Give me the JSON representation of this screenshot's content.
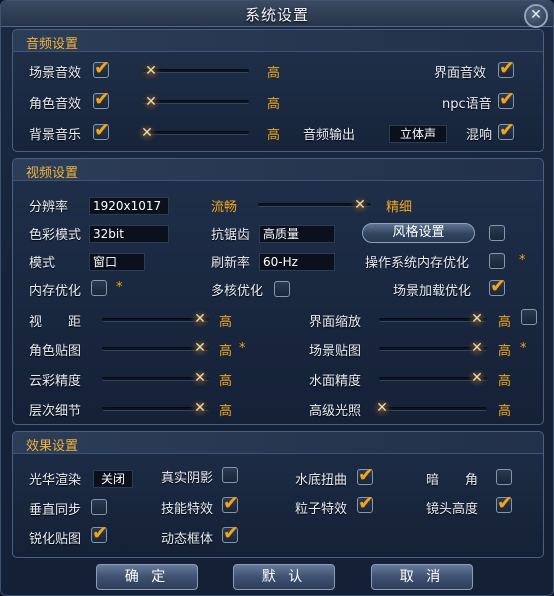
{
  "window": {
    "title": "系统设置",
    "close_glyph": "✕"
  },
  "audio": {
    "header": "音频设置",
    "scene_sound": {
      "label": "场景音效",
      "checked": true,
      "value": "高"
    },
    "role_sound": {
      "label": "角色音效",
      "checked": true,
      "value": "高"
    },
    "bgm": {
      "label": "背景音乐",
      "checked": true,
      "value": "高"
    },
    "ui_sound": {
      "label": "界面音效",
      "checked": true
    },
    "npc_voice": {
      "label": "npc语音",
      "checked": true
    },
    "output": {
      "label": "音频输出",
      "value": "立体声"
    },
    "reverb": {
      "label": "混响",
      "checked": true
    }
  },
  "video": {
    "header": "视频设置",
    "resolution": {
      "label": "分辨率",
      "value": "1920x1017"
    },
    "color_mode": {
      "label": "色彩模式",
      "value": "32bit"
    },
    "mode": {
      "label": "模式",
      "value": "窗口"
    },
    "memory_opt": {
      "label": "内存优化",
      "checked": false,
      "star": "*"
    },
    "quality": {
      "left_label": "流畅",
      "right_label": "精细"
    },
    "antialias": {
      "label": "抗锯齿",
      "value": "高质量"
    },
    "refresh": {
      "label": "刷新率",
      "value": "60-Hz"
    },
    "multicore": {
      "label": "多核优化",
      "checked": false
    },
    "style_button": "风格设置",
    "style_checked": false,
    "os_memory": {
      "label": "操作系统内存优化",
      "checked": false,
      "star": "*"
    },
    "scene_loading": {
      "label": "场景加载优化",
      "checked": true
    },
    "view_distance": {
      "label": "视　　距",
      "value": "高"
    },
    "ui_scale": {
      "label": "界面缩放",
      "value": "高",
      "checked": false
    },
    "role_texture": {
      "label": "角色贴图",
      "value": "高",
      "star": "*"
    },
    "scene_texture": {
      "label": "场景贴图",
      "value": "高",
      "star": "*"
    },
    "cloud": {
      "label": "云彩精度",
      "value": "高"
    },
    "water": {
      "label": "水面精度",
      "value": "高"
    },
    "lod": {
      "label": "层次细节",
      "value": "高"
    },
    "hdr_light": {
      "label": "高级光照",
      "value": "高"
    }
  },
  "effects": {
    "header": "效果设置",
    "bloom": {
      "label": "光华渲染",
      "value": "关闭"
    },
    "shadow": {
      "label": "真实阴影",
      "checked": false
    },
    "underwater": {
      "label": "水底扭曲",
      "checked": true
    },
    "vignette": {
      "label": "暗　　角",
      "checked": false
    },
    "vsync": {
      "label": "垂直同步",
      "checked": false
    },
    "skill_fx": {
      "label": "技能特效",
      "checked": true
    },
    "particle": {
      "label": "粒子特效",
      "checked": true
    },
    "lens_height": {
      "label": "镜头高度",
      "checked": true
    },
    "sharpen": {
      "label": "锐化贴图",
      "checked": true
    },
    "dynamic_frame": {
      "label": "动态框体",
      "checked": true
    }
  },
  "icons": {
    "slider_thumb": "slider-thumb-icon",
    "checkmark": "checkmark-icon"
  },
  "buttons": {
    "ok": "确 定",
    "default": "默 认",
    "cancel": "取 消"
  },
  "colors": {
    "accent": "#f2a51a",
    "header_text": "#f0b43c",
    "background": "#15223a"
  }
}
